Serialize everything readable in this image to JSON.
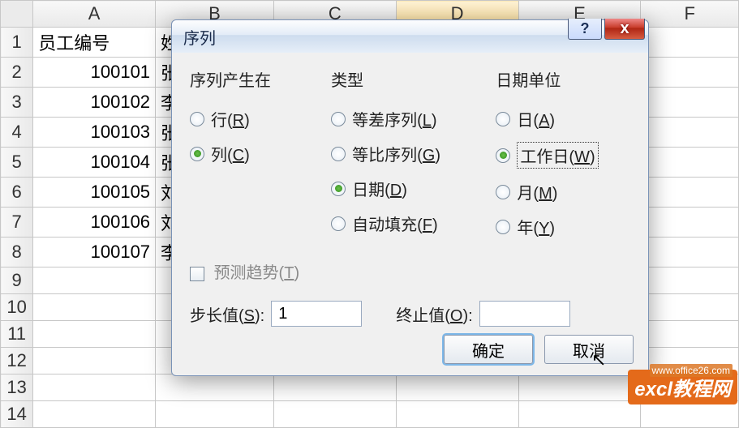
{
  "columns": [
    "A",
    "B",
    "C",
    "D",
    "E",
    "F"
  ],
  "selectedCol": "D",
  "headerRow": {
    "A": "员工编号",
    "B": "姓名"
  },
  "rows": [
    {
      "n": "1"
    },
    {
      "n": "2",
      "A": "100101",
      "B": "张三"
    },
    {
      "n": "3",
      "A": "100102",
      "B": "李思"
    },
    {
      "n": "4",
      "A": "100103",
      "B": "张毅"
    },
    {
      "n": "5",
      "A": "100104",
      "B": "张罗"
    },
    {
      "n": "6",
      "A": "100105",
      "B": "刘鄂"
    },
    {
      "n": "7",
      "A": "100106",
      "B": "刘希"
    },
    {
      "n": "8",
      "A": "100107",
      "B": "李亚"
    },
    {
      "n": "9"
    },
    {
      "n": "10"
    },
    {
      "n": "11"
    },
    {
      "n": "12"
    },
    {
      "n": "13"
    },
    {
      "n": "14"
    }
  ],
  "dialog": {
    "title": "序列",
    "help": "?",
    "close": "x",
    "group1": {
      "title": "序列产生在",
      "row": {
        "label": "行(",
        "u": "R",
        "tail": ")"
      },
      "col": {
        "label": "列(",
        "u": "C",
        "tail": ")"
      }
    },
    "group2": {
      "title": "类型",
      "linear": {
        "label": "等差序列(",
        "u": "L",
        "tail": ")"
      },
      "growth": {
        "label": "等比序列(",
        "u": "G",
        "tail": ")"
      },
      "date": {
        "label": "日期(",
        "u": "D",
        "tail": ")"
      },
      "autofill": {
        "label": "自动填充(",
        "u": "F",
        "tail": ")"
      }
    },
    "group3": {
      "title": "日期单位",
      "day": {
        "label": "日(",
        "u": "A",
        "tail": ")"
      },
      "wday": {
        "label": "工作日(",
        "u": "W",
        "tail": ")"
      },
      "month": {
        "label": "月(",
        "u": "M",
        "tail": ")"
      },
      "year": {
        "label": "年(",
        "u": "Y",
        "tail": ")"
      }
    },
    "trend": {
      "label": "预测趋势(",
      "u": "T",
      "tail": ")"
    },
    "step": {
      "label": "步长值(",
      "u": "S",
      "tail": "):",
      "value": "1"
    },
    "stop": {
      "label": "终止值(",
      "u": "O",
      "tail": "):",
      "value": ""
    },
    "ok": "确定",
    "cancel": "取消"
  },
  "watermark": {
    "text": "excl教程网",
    "url": "www.office26.com"
  }
}
